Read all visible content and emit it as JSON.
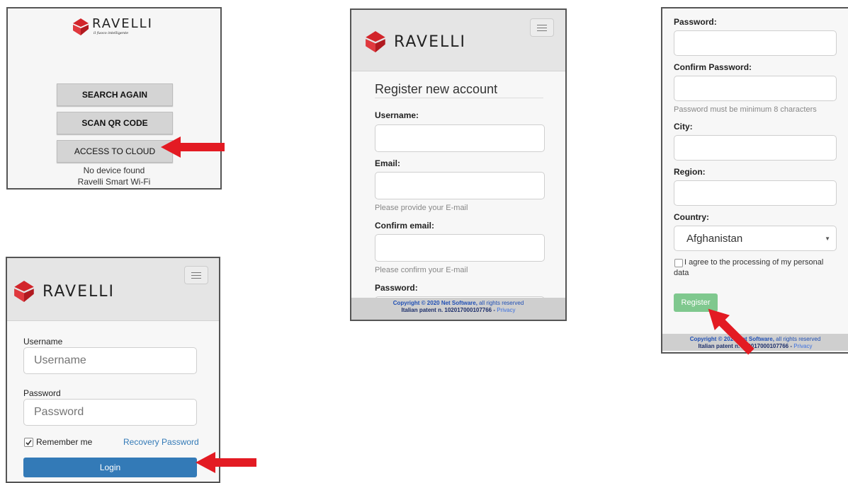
{
  "colors": {
    "brand_red": "#d2252b",
    "arrow_red": "#e31b23",
    "login_blue": "#337ab7",
    "register_green": "#7fc88e"
  },
  "brand": {
    "name": "RAVELLI",
    "tagline": "il fuoco intelligente"
  },
  "panel_search": {
    "buttons": [
      "SEARCH AGAIN",
      "SCAN QR CODE",
      "ACCESS TO CLOUD"
    ],
    "status_line1": "No device found",
    "status_line2": "Ravelli Smart Wi-Fi"
  },
  "panel_login": {
    "username_label": "Username",
    "username_placeholder": "Username",
    "password_label": "Password",
    "password_placeholder": "Password",
    "remember_label": "Remember me",
    "remember_checked": true,
    "recovery_link": "Recovery Password",
    "login_button": "Login"
  },
  "panel_register": {
    "title": "Register new account",
    "username_label": "Username:",
    "email_label": "Email:",
    "email_help": "Please provide your E-mail",
    "confirm_email_label": "Confirm email:",
    "confirm_email_help": "Please confirm your E-mail",
    "password_label": "Password:"
  },
  "panel_register2": {
    "password_label": "Password:",
    "confirm_password_label": "Confirm Password:",
    "password_help": "Password must be minimum 8 characters",
    "city_label": "City:",
    "region_label": "Region:",
    "country_label": "Country:",
    "country_value": "Afghanistan",
    "agree_line1": "I agree to the processing of my personal",
    "agree_line2": "data",
    "register_button": "Register"
  },
  "footer": {
    "copyright": "Copyright © 2020 Net Software,",
    "rights": " all rights reserved",
    "patent": "Italian patent n. 102017000107766 -",
    "privacy": " Privacy"
  },
  "icons": [
    "ravelli-logo-icon",
    "hamburger-menu-icon",
    "checkbox-icon",
    "dropdown-caret-icon",
    "red-arrow-icon"
  ]
}
